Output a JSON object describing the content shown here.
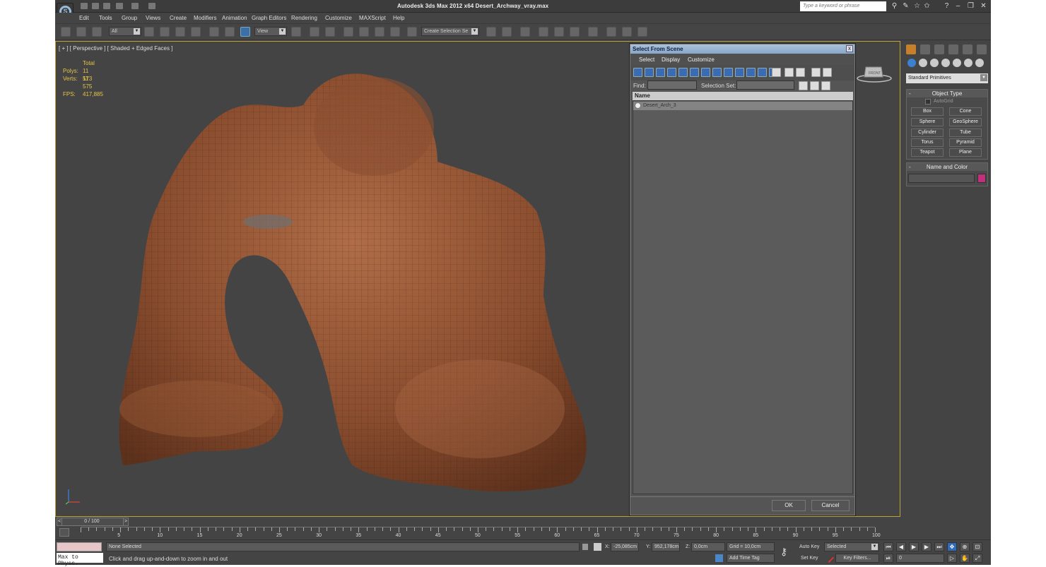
{
  "app": {
    "title": "Autodesk 3ds Max  2012 x64     Desert_Archway_vray.max",
    "search_placeholder": "Type a keyword or phrase"
  },
  "menubar": [
    "Edit",
    "Tools",
    "Group",
    "Views",
    "Create",
    "Modifiers",
    "Animation",
    "Graph Editors",
    "Rendering",
    "Customize",
    "MAXScript",
    "Help"
  ],
  "toolbar": {
    "filter_value": "All",
    "refcoord_value": "View",
    "selset_value": "Create Selection Se"
  },
  "viewport": {
    "label": "[ + ] [ Perspective ] [ Shaded + Edged Faces ]",
    "stats": {
      "total_label": "Total",
      "polys_label": "Polys:",
      "polys_value": "11 573",
      "verts_label": "Verts:",
      "verts_value": "11 575",
      "fps_label": "FPS:",
      "fps_value": "417,885"
    },
    "viewcube_label": "FRONT"
  },
  "dialog": {
    "title": "Select From Scene",
    "close": "x",
    "menu": [
      "Select",
      "Display",
      "Customize"
    ],
    "find_label": "Find:",
    "selset_label": "Selection Set:",
    "column_header": "Name",
    "items": [
      "Desert_Arch_3"
    ],
    "ok": "OK",
    "cancel": "Cancel"
  },
  "command_panel": {
    "category": "Standard Primitives",
    "object_type_title": "Object Type",
    "autogrid_label": "AutoGrid",
    "primitives": [
      "Box",
      "Cone",
      "Sphere",
      "GeoSphere",
      "Cylinder",
      "Tube",
      "Torus",
      "Pyramid",
      "Teapot",
      "Plane"
    ],
    "name_color_title": "Name and Color",
    "swatch_color": "#c2307c"
  },
  "timeline": {
    "slider_label": "0 / 100",
    "ticks": [
      "5",
      "10",
      "15",
      "20",
      "25",
      "30",
      "35",
      "40",
      "45",
      "50",
      "55",
      "60",
      "65",
      "70",
      "75",
      "80",
      "85",
      "90",
      "95",
      "100"
    ]
  },
  "status": {
    "maxscript": "Max to Physc.",
    "selection": "None Selected",
    "prompt": "Click and drag up-and-down to zoom in and out",
    "x_label": "X:",
    "x_value": "-25,085cm",
    "y_label": "Y:",
    "y_value": "952,178cm",
    "z_label": "Z:",
    "z_value": "0,0cm",
    "grid": "Grid = 10,0cm",
    "add_time_tag": "Add Time Tag",
    "auto_key": "Auto Key",
    "set_key": "Set Key",
    "key_mode": "Selected",
    "key_filters": "Key Filters...",
    "frame": "0"
  }
}
